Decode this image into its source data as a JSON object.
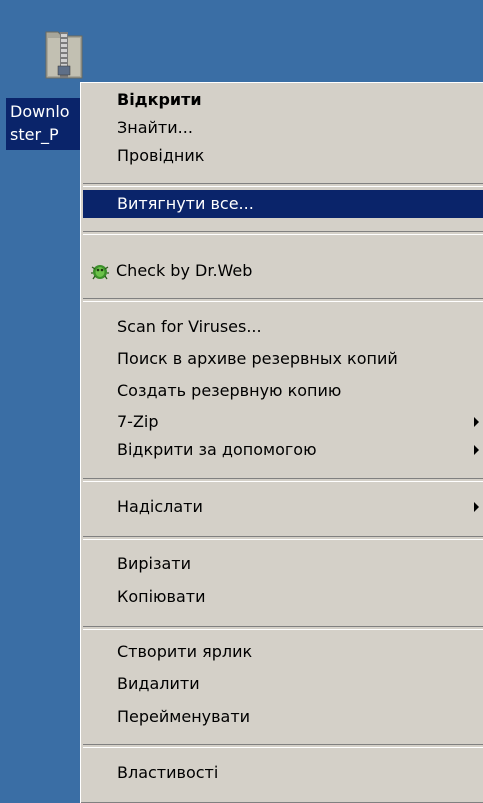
{
  "desktop": {
    "file": {
      "icon": "zip-folder-icon",
      "label_line1": "Downlo",
      "label_line2": "ster_P"
    }
  },
  "context_menu": {
    "items": [
      {
        "label": "Відкрити",
        "bold": true
      },
      {
        "label": "Знайти..."
      },
      {
        "label": "Провідник"
      },
      {
        "label": "Витягнути все...",
        "selected": true
      },
      {
        "label": "Check by Dr.Web",
        "icon": "dr-web-spider-icon"
      },
      {
        "label": "Scan for Viruses..."
      },
      {
        "label": "Поиск в архиве резервных копий"
      },
      {
        "label": "Создать резервную копию"
      },
      {
        "label": "7-Zip",
        "submenu": true
      },
      {
        "label": "Відкрити за допомогою",
        "submenu": true
      },
      {
        "label": "Надіслати",
        "submenu": true
      },
      {
        "label": "Вирізати"
      },
      {
        "label": "Копіювати"
      },
      {
        "label": "Створити ярлик"
      },
      {
        "label": "Видалити"
      },
      {
        "label": "Перейменувати"
      },
      {
        "label": "Властивості"
      }
    ]
  },
  "colors": {
    "desktop_bg": "#3a6ea5",
    "menu_bg": "#d4d0c8",
    "highlight": "#0a246a"
  }
}
